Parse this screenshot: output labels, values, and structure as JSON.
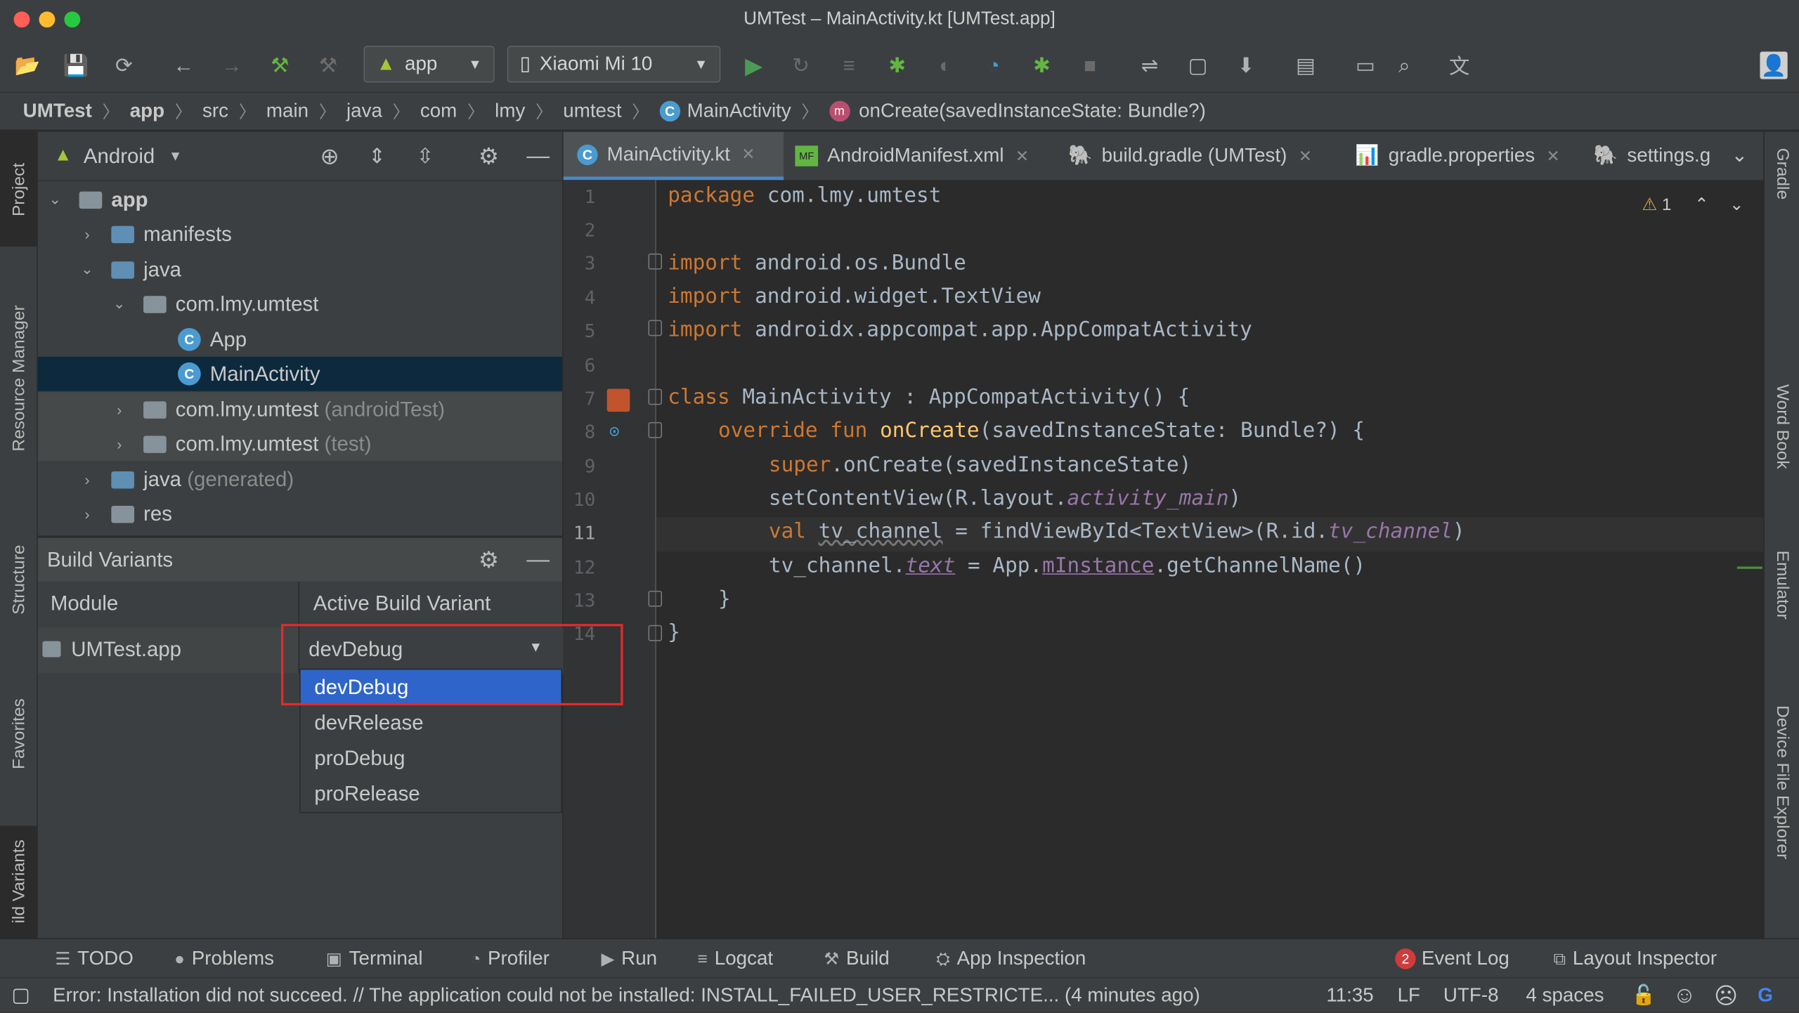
{
  "window": {
    "title": "UMTest – MainActivity.kt [UMTest.app]"
  },
  "toolbar": {
    "run_config": "app",
    "device": "Xiaomi Mi 10"
  },
  "breadcrumb": [
    "UMTest",
    "app",
    "src",
    "main",
    "java",
    "com",
    "lmy",
    "umtest",
    "MainActivity",
    "onCreate(savedInstanceState: Bundle?)"
  ],
  "left_tabs": [
    "Project",
    "Resource Manager",
    "Structure",
    "Favorites",
    "ild Variants"
  ],
  "right_tabs": [
    "Gradle",
    "Word Book",
    "Emulator",
    "Device File Explorer"
  ],
  "project": {
    "view_mode": "Android",
    "tree": [
      {
        "label": "app",
        "extra": ""
      },
      {
        "label": "manifests",
        "extra": ""
      },
      {
        "label": "java",
        "extra": ""
      },
      {
        "label": "com.lmy.umtest",
        "extra": ""
      },
      {
        "label": "App",
        "extra": ""
      },
      {
        "label": "MainActivity",
        "extra": ""
      },
      {
        "label": "com.lmy.umtest",
        "extra": "(androidTest)"
      },
      {
        "label": "com.lmy.umtest",
        "extra": "(test)"
      },
      {
        "label": "java",
        "extra": "(generated)"
      },
      {
        "label": "res",
        "extra": ""
      }
    ]
  },
  "build_variants": {
    "title": "Build Variants",
    "col_module": "Module",
    "col_variant": "Active Build Variant",
    "row_module": "UMTest.app",
    "row_variant": "devDebug",
    "options": [
      "devDebug",
      "devRelease",
      "proDebug",
      "proRelease"
    ]
  },
  "editor": {
    "tabs": [
      "MainActivity.kt",
      "AndroidManifest.xml",
      "build.gradle (UMTest)",
      "gradle.properties",
      "settings.g"
    ],
    "warning_count": "1",
    "line_numbers": [
      "1",
      "2",
      "3",
      "4",
      "5",
      "6",
      "7",
      "8",
      "9",
      "10",
      "11",
      "12",
      "13",
      "14"
    ],
    "code": {
      "l1_kw": "package",
      "l1_rest": " com.lmy.umtest",
      "l3_kw": "import",
      "l3_rest": " android.os.Bundle",
      "l4_kw": "import",
      "l4_rest": " android.widget.TextView",
      "l5_kw": "import",
      "l5_rest": " androidx.appcompat.app.AppCompatActivity",
      "l7_kw": "class",
      "l7_rest": " MainActivity : AppCompatActivity() {",
      "l8_kw": "override fun",
      "l8_fn": "onCreate",
      "l8_rest": "(savedInstanceState: Bundle?) {",
      "l9_kw": "super",
      "l9_rest": ".onCreate(savedInstanceState)",
      "l10_a": "setContentView(R.layout.",
      "l10_it": "activity_main",
      "l10_b": ")",
      "l11_kw": "val",
      "l11_var": "tv_channel",
      "l11_a": " = findViewById<TextView>(R.id.",
      "l11_it": "tv_channel",
      "l11_b": ")",
      "l12_a": "tv_channel.",
      "l12_it": "text",
      "l12_b": " = App.",
      "l12_pp": "mInstance",
      "l12_c": ".getChannelName()",
      "l13": "}",
      "l14": "}"
    }
  },
  "bottom_tabs": [
    "TODO",
    "Problems",
    "Terminal",
    "Profiler",
    "Run",
    "Logcat",
    "Build",
    "App Inspection"
  ],
  "bottom_right": {
    "event_badge": "2",
    "event_log": "Event Log",
    "layout_inspector": "Layout Inspector"
  },
  "status": {
    "message": "Error: Installation did not succeed. // The application could not be installed: INSTALL_FAILED_USER_RESTRICTE... (4 minutes ago)",
    "position": "11:35",
    "line_sep": "LF",
    "encoding": "UTF-8",
    "indent": "4 spaces"
  }
}
